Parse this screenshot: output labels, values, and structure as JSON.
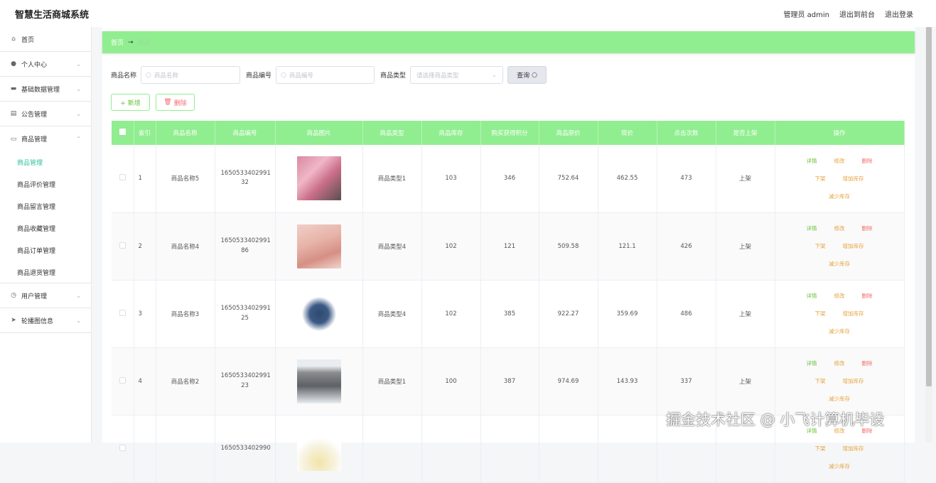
{
  "app": {
    "title": "智慧生活商城系统"
  },
  "top_links": {
    "admin": "管理员 admin",
    "to_front": "退出到前台",
    "logout": "退出登录"
  },
  "sidebar": {
    "home": "首页",
    "personal": "个人中心",
    "basic": "基础数据管理",
    "notice": "公告管理",
    "goods": "商品管理",
    "sub": [
      "商品管理",
      "商品评价管理",
      "商品留言管理",
      "商品收藏管理",
      "商品订单管理",
      "商品退货管理"
    ],
    "users": "用户管理",
    "carousel": "轮播图信息"
  },
  "breadcrumb": {
    "home": "首页",
    "arrow": "→",
    "current": "商品"
  },
  "search": {
    "name_label": "商品名称",
    "name_placeholder": "商品名称",
    "code_label": "商品编号",
    "code_placeholder": "商品编号",
    "type_label": "商品类型",
    "type_placeholder": "请选择商品类型",
    "query_label": "查询"
  },
  "actions": {
    "add": "+ 新增",
    "delete": "删除"
  },
  "table": {
    "headers": [
      "索引",
      "商品名称",
      "商品编号",
      "商品图片",
      "商品类型",
      "商品库存",
      "购买获得积分",
      "商品原价",
      "现价",
      "点击次数",
      "是否上架",
      "操作"
    ],
    "rows": [
      {
        "index": "1",
        "name": "商品名称5",
        "code": "1650533402991 32",
        "type": "商品类型1",
        "stock": "103",
        "points": "346",
        "orig": "752.64",
        "price": "462.55",
        "clicks": "473",
        "status": "上架"
      },
      {
        "index": "2",
        "name": "商品名称4",
        "code": "1650533402991 86",
        "type": "商品类型4",
        "stock": "102",
        "points": "121",
        "orig": "509.58",
        "price": "121.1",
        "clicks": "426",
        "status": "上架"
      },
      {
        "index": "3",
        "name": "商品名称3",
        "code": "1650533402991 25",
        "type": "商品类型4",
        "stock": "102",
        "points": "385",
        "orig": "922.27",
        "price": "359.69",
        "clicks": "486",
        "status": "上架"
      },
      {
        "index": "4",
        "name": "商品名称2",
        "code": "1650533402991 23",
        "type": "商品类型1",
        "stock": "100",
        "points": "387",
        "orig": "974.69",
        "price": "143.93",
        "clicks": "337",
        "status": "上架"
      },
      {
        "index": "",
        "name": "",
        "code": "1650533402990",
        "type": "",
        "stock": "",
        "points": "",
        "orig": "",
        "price": "",
        "clicks": "",
        "status": ""
      }
    ],
    "ops": {
      "detail": "详情",
      "edit": "修改",
      "del": "删除",
      "off": "下架",
      "add_stock": "增加库存",
      "reduce_stock": "减少库存"
    }
  },
  "watermark": "掘金技术社区 @ 小飞计算机毕设",
  "colors": {
    "accent": "#90ee90",
    "active": "#2ec09c",
    "danger": "#f56c6c",
    "warning": "#e6a23c"
  }
}
